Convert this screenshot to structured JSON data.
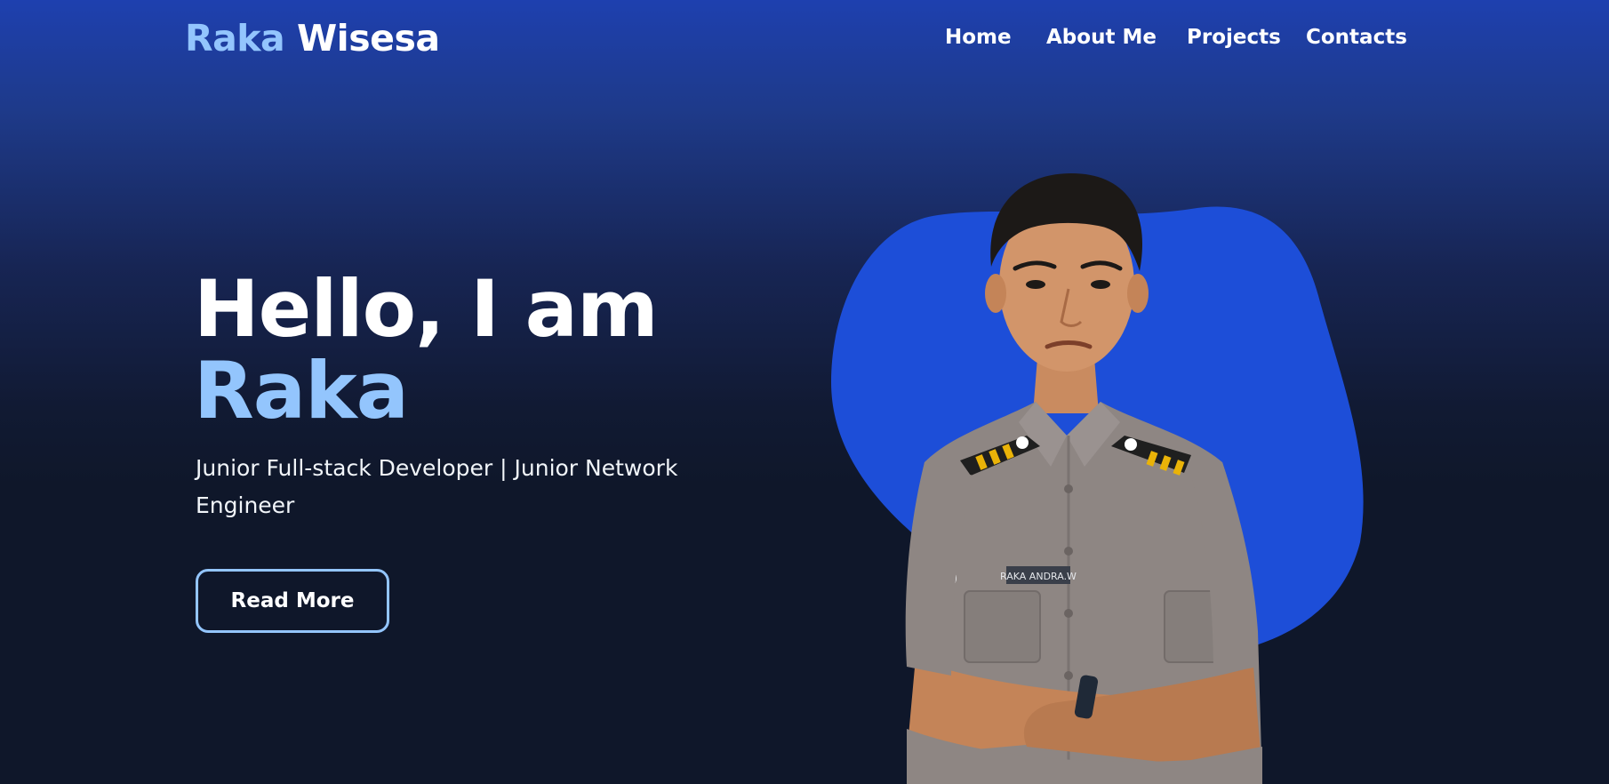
{
  "navbar": {
    "logo_first": "Raka",
    "logo_last": "Wisesa",
    "links": [
      {
        "label": "Home"
      },
      {
        "label": "About Me"
      },
      {
        "label": "Projects"
      },
      {
        "label": "Contacts"
      }
    ]
  },
  "hero": {
    "greeting": "Hello, I am",
    "name": "Raka",
    "subtitle": "Junior Full-stack Developer | Junior Network Engineer",
    "button_label": "Read More",
    "photo_name_tag": "RAKA ANDRA.W"
  },
  "colors": {
    "accent": "#93c5fd",
    "blob": "#1d4ed8",
    "background_top": "#1e40af",
    "background_bottom": "#0f172a",
    "text": "#ffffff"
  }
}
